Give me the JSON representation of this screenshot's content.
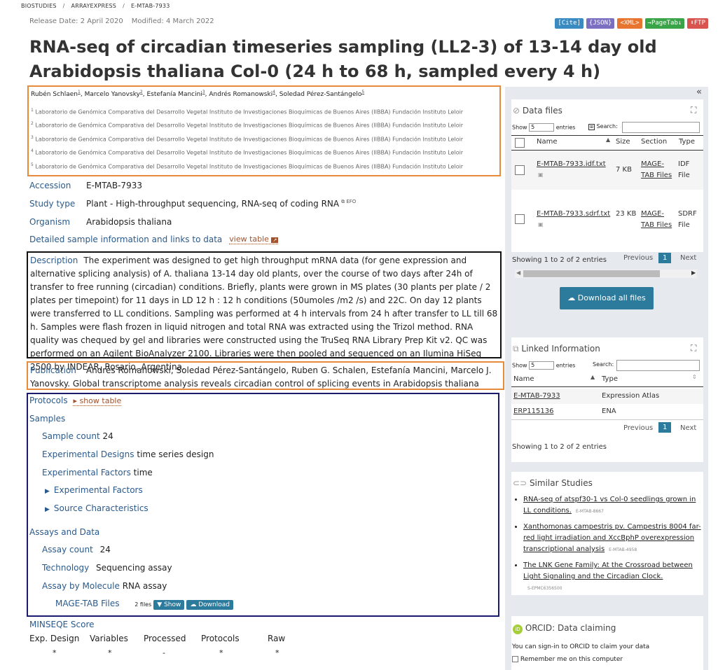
{
  "breadcrumb": {
    "items": [
      "BIOSTUDIES",
      "ARRAYEXPRESS",
      "E-MTAB-7933"
    ],
    "sep": "/"
  },
  "dates": {
    "release": "Release Date: 2 April 2020",
    "modified": "Modified: 4 March 2022"
  },
  "top_buttons": [
    {
      "label": "[Cite]",
      "color": "#3a8bc2"
    },
    {
      "label": "{JSON}",
      "color": "#7b6fc2"
    },
    {
      "label": "<XML>",
      "color": "#e8752f"
    },
    {
      "label": "→PageTab↓",
      "color": "#3aa548"
    },
    {
      "label": "⬇FTP",
      "color": "#d9534f"
    }
  ],
  "title": "RNA-seq of circadian timeseries sampling (LL2-3) of 13-14 day old Arabidopsis thaliana Col-0 (24 h to 68 h, sampled every 4 h)",
  "authors": [
    {
      "name": "Rubén Schlaen",
      "ref": "1"
    },
    {
      "name": "Marcelo Yanovsky",
      "ref": "2"
    },
    {
      "name": "Estefanía Mancini",
      "ref": "3"
    },
    {
      "name": "Andrés Romanowski",
      "ref": "4"
    },
    {
      "name": "Soledad Pérez-Santángelo",
      "ref": "5"
    }
  ],
  "affiliations": [
    {
      "ref": "1",
      "text": "Laboratorio de Genómica Comparativa del Desarrollo Vegetal Instituto de Investigaciones Bioquímicas de Buenos Aires (IIBBA) Fundación Instituto Leloir"
    },
    {
      "ref": "2",
      "text": "Laboratorio de Genómica Comparativa del Desarrollo Vegetal Instituto de Investigaciones Bioquímicas de Buenos Aires (IIBBA) Fundación Instituto Leloir"
    },
    {
      "ref": "3",
      "text": "Laboratorio de Genómica Comparativa del Desarrollo Vegetal Instituto de Investigaciones Bioquímicas de Buenos Aires (IIBBA) Fundación Instituto Leloir"
    },
    {
      "ref": "4",
      "text": "Laboratorio de Genómica Comparativa del Desarrollo Vegetal Instituto de Investigaciones Bioquímicas de Buenos Aires (IIBBA) Fundación Instituto Leloir"
    },
    {
      "ref": "5",
      "text": "Laboratorio de Genómica Comparativa del Desarrollo Vegetal Instituto de Investigaciones Bioquímicas de Buenos Aires (IIBBA) Fundación Instituto Leloir"
    }
  ],
  "accession": {
    "label": "Accession",
    "value": "E-MTAB-7933"
  },
  "study_type": {
    "label": "Study type",
    "value": "Plant - High-throughput sequencing, RNA-seq of coding RNA",
    "tag": "EFO"
  },
  "organism": {
    "label": "Organism",
    "value": "Arabidopsis thaliana"
  },
  "detailed": {
    "label": "Detailed sample information and links to data",
    "link": "view table"
  },
  "description": {
    "label": "Description",
    "text": "The experiment was designed to get high throughput mRNA data (for gene expression and alternative splicing analysis) of A. thaliana 13-14 day old plants, over the course of two days after 24h of transfer to free running (circadian) conditions. Briefly, plants were grown in MS plates (30 plants per plate / 2 plates per timepoint) for 11 days in LD 12 h : 12 h conditions (50umoles /m2 /s) and 22C. On day 12 plants were transferred to LL conditions. Sampling was performed at 4 h intervals from 24 h after transfer to LL till 68 h. Samples were flash frozen in liquid nitrogen and total RNA was extracted using the Trizol method. RNA quality was chequed by gel and libraries were constructed using the TruSeq RNA Library Prep Kit v2. QC was performed on an Agilent BioAnalyzer 2100. Libraries were then pooled and sequenced on an Ilumina HiSeq 2500 by INDEAR, Rosario, Argentina."
  },
  "publication": {
    "label": "Publication",
    "text": "Andrés Romanowski, Soledad Pérez-Santángelo, Ruben G. Schalen, Estefanía Mancini, Marcelo J. Yanovsky. Global transcriptome analysis reveals circadian control of splicing events in Arabidopsis thaliana"
  },
  "protocols": {
    "label": "Protocols",
    "link": "show table"
  },
  "samples": {
    "label": "Samples",
    "count_label": "Sample count",
    "count": "24",
    "designs_label": "Experimental Designs",
    "designs": "time series design",
    "factors_label": "Experimental Factors",
    "factors": "time",
    "exp_factors": "Experimental Factors",
    "source_chars": "Source Characteristics"
  },
  "assays": {
    "label": "Assays and Data",
    "count_label": "Assay count",
    "count": "24",
    "tech_label": "Technology",
    "tech": "Sequencing assay",
    "molecule_label": "Assay by Molecule",
    "molecule": "RNA assay",
    "magetab": "MAGE-TAB Files",
    "files": "2 files",
    "show": "Show",
    "download": "Download"
  },
  "minseqe": {
    "label": "MINSEQE Score",
    "cols": [
      "Exp. Design",
      "Variables",
      "Processed",
      "Protocols",
      "Raw"
    ],
    "marks": [
      "*",
      "*",
      "-",
      "*",
      "*"
    ]
  },
  "side": {
    "collapse": "«",
    "data_files": {
      "title": "Data files",
      "show": "Show",
      "entries": "entries",
      "select": "5",
      "search": "Search:",
      "cols": [
        "Name",
        "Size",
        "Section",
        "Type"
      ],
      "rows": [
        {
          "name": "E-MTAB-7933.idf.txt",
          "size": "7 KB",
          "section": "MAGE-TAB Files",
          "type": "IDF File"
        },
        {
          "name": "E-MTAB-7933.sdrf.txt",
          "size": "23 KB",
          "section": "MAGE-TAB Files",
          "type": "SDRF File"
        }
      ],
      "info": "Showing 1 to 2 of 2 entries",
      "prev": "Previous",
      "page": "1",
      "next": "Next",
      "download_all": "Download all files"
    },
    "linked": {
      "title": "Linked Information",
      "show": "Show",
      "entries": "entries",
      "select": "5",
      "search": "Search:",
      "cols": [
        "Name",
        "Type"
      ],
      "rows": [
        {
          "name": "E-MTAB-7933",
          "type": "Expression Atlas"
        },
        {
          "name": "ERP115136",
          "type": "ENA"
        }
      ],
      "info": "Showing 1 to 2 of 2 entries",
      "prev": "Previous",
      "page": "1",
      "next": "Next"
    },
    "similar": {
      "title": "Similar Studies",
      "items": [
        {
          "text": "RNA-seq of atspf30-1 vs Col-0 seedlings grown in LL conditions.",
          "id": "E-MTAB-8667"
        },
        {
          "text": "Xanthomonas campestris pv. Campestris 8004 far-red light irradiation and XccBphP overexpression transcriptional analysis",
          "id": "E-MTAB-4958"
        },
        {
          "text": "The LNK Gene Family: At the Crossroad between Light Signaling and the Circadian Clock.",
          "id": "S-EPMC6356500"
        }
      ]
    },
    "orcid": {
      "title": "ORCID: Data claiming",
      "text": "You can sign-in to ORCID to claim your data",
      "remember": "Remember me on this computer"
    }
  }
}
